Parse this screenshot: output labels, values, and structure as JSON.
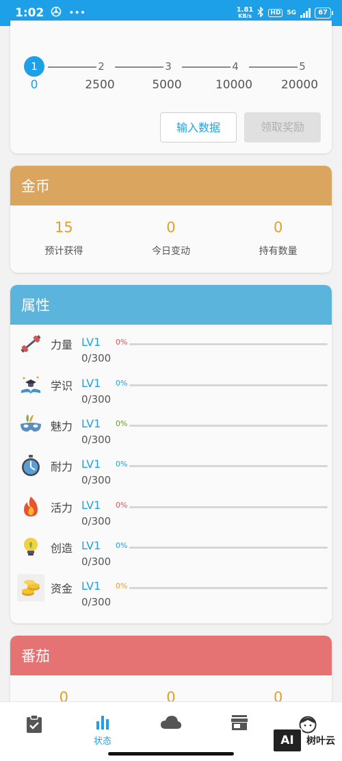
{
  "status_bar": {
    "time": "1:02",
    "net_speed_value": "1.81",
    "net_speed_unit": "KB/s",
    "hd": "HD",
    "network": "5G",
    "battery": "67",
    "color": "#1ea0e8"
  },
  "progress": {
    "steps": [
      "1",
      "2",
      "3",
      "4",
      "5"
    ],
    "values": [
      "0",
      "2500",
      "5000",
      "10000",
      "20000"
    ],
    "input_button": "输入数据",
    "claim_button": "领取奖励"
  },
  "coins": {
    "title": "金币",
    "color": "#d9a55f",
    "stats": [
      {
        "value": "15",
        "label": "预计获得"
      },
      {
        "value": "0",
        "label": "今日变动"
      },
      {
        "value": "0",
        "label": "持有数量"
      }
    ]
  },
  "attributes": {
    "title": "属性",
    "color": "#5ab4dc",
    "items": [
      {
        "name": "力量",
        "level": "LV1",
        "exp": "0/300",
        "percent": "0%",
        "pct_color": "#d9534f",
        "icon": "dumbbell-icon"
      },
      {
        "name": "学识",
        "level": "LV1",
        "exp": "0/300",
        "percent": "0%",
        "pct_color": "#1ea0e8",
        "icon": "book-icon"
      },
      {
        "name": "魅力",
        "level": "LV1",
        "exp": "0/300",
        "percent": "0%",
        "pct_color": "#6a9a1f",
        "icon": "mask-icon"
      },
      {
        "name": "耐力",
        "level": "LV1",
        "exp": "0/300",
        "percent": "0%",
        "pct_color": "#1ea0e8",
        "icon": "stopwatch-icon"
      },
      {
        "name": "活力",
        "level": "LV1",
        "exp": "0/300",
        "percent": "0%",
        "pct_color": "#d9534f",
        "icon": "flame-icon"
      },
      {
        "name": "创造",
        "level": "LV1",
        "exp": "0/300",
        "percent": "0%",
        "pct_color": "#1ea0e8",
        "icon": "lightbulb-icon"
      },
      {
        "name": "资金",
        "level": "LV1",
        "exp": "0/300",
        "percent": "0%",
        "pct_color": "#e0a030",
        "icon": "coins-icon"
      }
    ]
  },
  "tomato": {
    "title": "番茄",
    "color": "#e57373",
    "stats": [
      {
        "value": "0"
      },
      {
        "value": "0"
      },
      {
        "value": "0"
      }
    ]
  },
  "bottom_nav": {
    "items": [
      {
        "icon": "task-clipboard-icon",
        "label": ""
      },
      {
        "icon": "bar-chart-icon",
        "label": "状态"
      },
      {
        "icon": "cloud-icon",
        "label": ""
      },
      {
        "icon": "store-icon",
        "label": ""
      },
      {
        "icon": "profile-face-icon",
        "label": ""
      }
    ],
    "active_color": "#1ea0e8"
  },
  "watermark": {
    "logo": "AI",
    "text": "树叶云"
  }
}
